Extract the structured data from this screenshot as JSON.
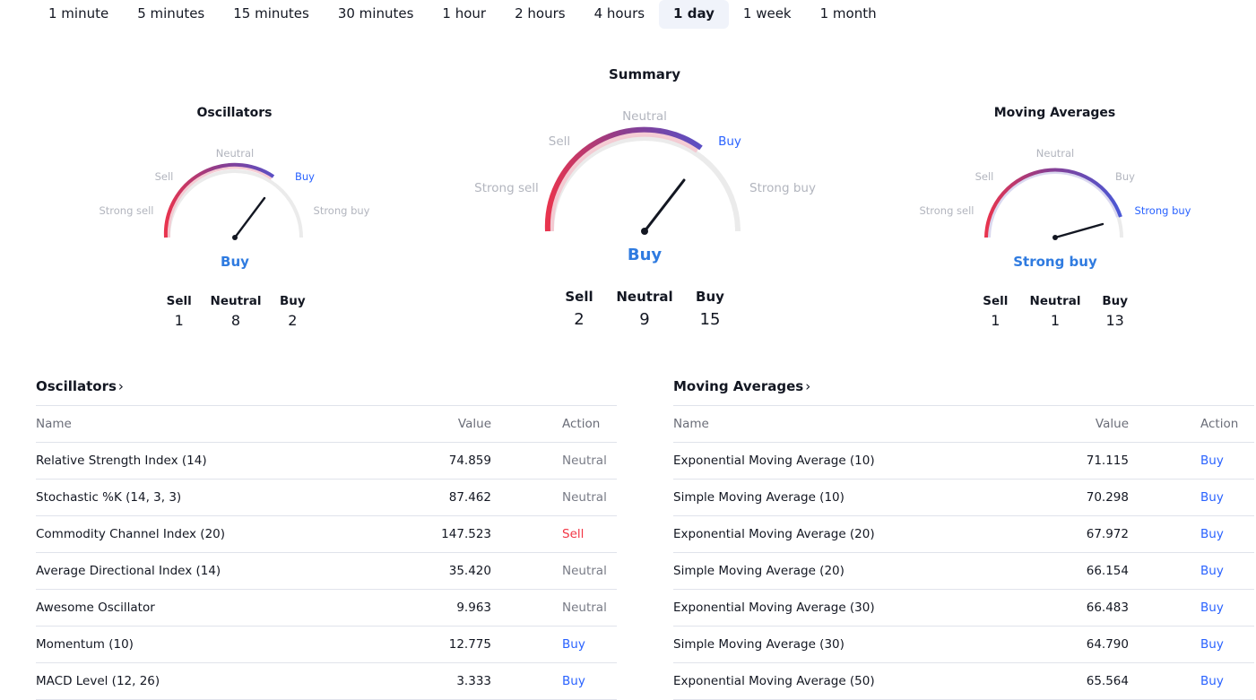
{
  "intervals": [
    {
      "label": "1 minute"
    },
    {
      "label": "5 minutes"
    },
    {
      "label": "15 minutes"
    },
    {
      "label": "30 minutes"
    },
    {
      "label": "1 hour"
    },
    {
      "label": "2 hours"
    },
    {
      "label": "4 hours"
    },
    {
      "label": "1 day",
      "active": true
    },
    {
      "label": "1 week"
    },
    {
      "label": "1 month"
    }
  ],
  "gauges": {
    "oscillators": {
      "title": "Oscillators",
      "scale": {
        "strong_sell": "Strong sell",
        "sell": "Sell",
        "neutral": "Neutral",
        "buy": "Buy",
        "strong_buy": "Strong buy"
      },
      "result": "Buy",
      "counts": {
        "sell_label": "Sell",
        "sell": "1",
        "neutral_label": "Neutral",
        "neutral": "8",
        "buy_label": "Buy",
        "buy": "2"
      }
    },
    "summary": {
      "title": "Summary",
      "scale": {
        "strong_sell": "Strong sell",
        "sell": "Sell",
        "neutral": "Neutral",
        "buy": "Buy",
        "strong_buy": "Strong buy"
      },
      "result": "Buy",
      "counts": {
        "sell_label": "Sell",
        "sell": "2",
        "neutral_label": "Neutral",
        "neutral": "9",
        "buy_label": "Buy",
        "buy": "15"
      }
    },
    "moving_averages": {
      "title": "Moving Averages",
      "scale": {
        "strong_sell": "Strong sell",
        "sell": "Sell",
        "neutral": "Neutral",
        "buy": "Buy",
        "strong_buy": "Strong buy"
      },
      "result": "Strong buy",
      "counts": {
        "sell_label": "Sell",
        "sell": "1",
        "neutral_label": "Neutral",
        "neutral": "1",
        "buy_label": "Buy",
        "buy": "13"
      }
    }
  },
  "colors": {
    "buy": "#2962ff",
    "sell": "#f23645",
    "neutral": "#787b86",
    "result_blue": "#2f7be0"
  },
  "oscillators_table": {
    "title": "Oscillators",
    "headers": {
      "name": "Name",
      "value": "Value",
      "action": "Action"
    },
    "rows": [
      {
        "name": "Relative Strength Index (14)",
        "value": "74.859",
        "action": "Neutral"
      },
      {
        "name": "Stochastic %K (14, 3, 3)",
        "value": "87.462",
        "action": "Neutral"
      },
      {
        "name": "Commodity Channel Index (20)",
        "value": "147.523",
        "action": "Sell"
      },
      {
        "name": "Average Directional Index (14)",
        "value": "35.420",
        "action": "Neutral"
      },
      {
        "name": "Awesome Oscillator",
        "value": "9.963",
        "action": "Neutral"
      },
      {
        "name": "Momentum (10)",
        "value": "12.775",
        "action": "Buy"
      },
      {
        "name": "MACD Level (12, 26)",
        "value": "3.333",
        "action": "Buy"
      }
    ]
  },
  "moving_averages_table": {
    "title": "Moving Averages",
    "headers": {
      "name": "Name",
      "value": "Value",
      "action": "Action"
    },
    "rows": [
      {
        "name": "Exponential Moving Average (10)",
        "value": "71.115",
        "action": "Buy"
      },
      {
        "name": "Simple Moving Average (10)",
        "value": "70.298",
        "action": "Buy"
      },
      {
        "name": "Exponential Moving Average (20)",
        "value": "67.972",
        "action": "Buy"
      },
      {
        "name": "Simple Moving Average (20)",
        "value": "66.154",
        "action": "Buy"
      },
      {
        "name": "Exponential Moving Average (30)",
        "value": "66.483",
        "action": "Buy"
      },
      {
        "name": "Simple Moving Average (30)",
        "value": "64.790",
        "action": "Buy"
      },
      {
        "name": "Exponential Moving Average (50)",
        "value": "65.564",
        "action": "Buy"
      }
    ]
  }
}
